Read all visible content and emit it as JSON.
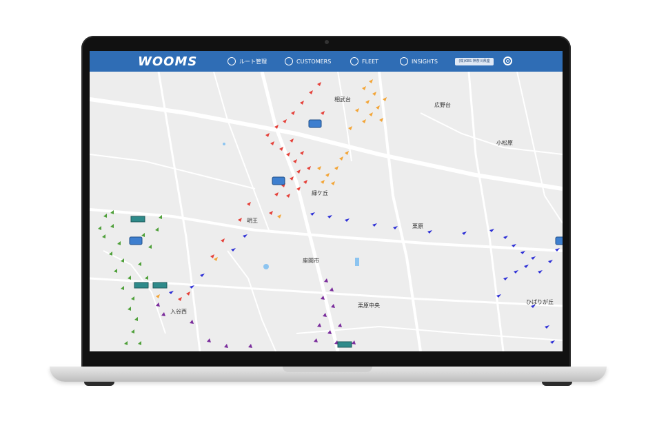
{
  "app": {
    "logo": "WOOMS"
  },
  "nav": {
    "items": [
      {
        "label": "ルート管理",
        "icon": "map-icon"
      },
      {
        "label": "CUSTOMERS",
        "icon": "person-icon"
      },
      {
        "label": "FLEET",
        "icon": "truck-icon"
      },
      {
        "label": "INSIGHTS",
        "icon": "chart-icon"
      }
    ],
    "badge": "(株)KBS 神奈川県座",
    "settings_icon": "gear-icon"
  },
  "map": {
    "labels": {
      "soubudai": "相武台",
      "hironodai": "広野台",
      "komatsubara": "小松原",
      "midorigaoka": "緑ケ丘",
      "myoou": "明王",
      "kurihara": "栗原",
      "zamashi": "座間市",
      "irinishi": "入谷西",
      "kuriharachuo": "栗原中央",
      "hibarigaoka": "ひばりが丘"
    },
    "route_colors": {
      "red": "#e5413a",
      "orange": "#f3a537",
      "blue": "#2d2fd6",
      "green": "#4fa03a",
      "purple": "#7a2c9c"
    }
  }
}
